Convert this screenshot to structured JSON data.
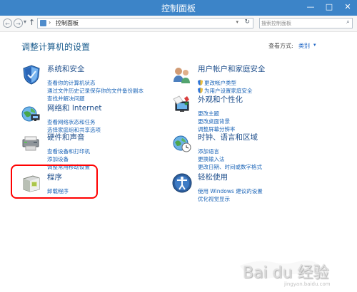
{
  "window": {
    "title": "控制面板",
    "buttons": {
      "minimize": "—",
      "maximize": "□",
      "close": "✕"
    }
  },
  "navigation": {
    "back_symbol": "←",
    "forward_symbol": "→",
    "recent_symbol": "▾",
    "up_symbol": "↑",
    "address_separator": "›",
    "address": "控制面板",
    "dropdown_symbol": "▾",
    "refresh_symbol": "↻"
  },
  "search": {
    "placeholder": "搜索控制面板",
    "icon_symbol": "⌕"
  },
  "page": {
    "heading": "调整计算机的设置",
    "view_by_label": "查看方式:",
    "view_by_value": "类别",
    "view_by_arrow": "▾"
  },
  "categories": [
    {
      "title": "系统和安全",
      "icon": "system-security-icon",
      "links": [
        "查看你的计算机状态",
        "通过文件历史记录保存你的文件备份副本",
        "查找并解决问题"
      ]
    },
    {
      "title": "网络和 Internet",
      "icon": "network-internet-icon",
      "links": [
        "查看网络状态和任务",
        "选择家庭组和共享选项"
      ]
    },
    {
      "title": "硬件和声音",
      "icon": "hardware-sound-icon",
      "links": [
        "查看设备和打印机",
        "添加设备",
        "调整常用移动设置"
      ]
    },
    {
      "title": "程序",
      "icon": "programs-icon",
      "links": [
        "卸载程序"
      ]
    },
    {
      "title": "用户帐户和家庭安全",
      "icon": "user-accounts-icon",
      "links": [
        "更改帐户类型",
        "为用户设置家庭安全"
      ]
    },
    {
      "title": "外观和个性化",
      "icon": "appearance-icon",
      "links": [
        "更改主题",
        "更改桌面背景",
        "调整屏幕分辨率"
      ]
    },
    {
      "title": "时钟、语言和区域",
      "icon": "clock-language-region-icon",
      "links": [
        "添加语言",
        "更换输入法",
        "更改日期、时间或数字格式"
      ]
    },
    {
      "title": "轻松使用",
      "icon": "ease-of-access-icon",
      "links": [
        "使用 Windows 建议的设置",
        "优化视觉显示"
      ]
    }
  ],
  "watermark": {
    "text": "Bai du 经验",
    "subtext": "jingyan.baidu.com"
  },
  "colors": {
    "title_bar": "#3c84c8",
    "link_blue": "#1d66b8",
    "heading_blue": "#1c5e8f",
    "highlight_red": "#ff0000"
  }
}
